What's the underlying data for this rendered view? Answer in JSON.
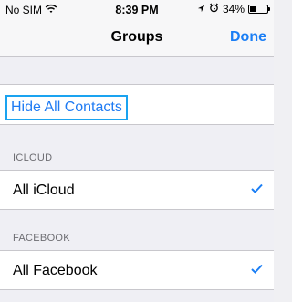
{
  "status_bar": {
    "carrier": "No SIM",
    "time": "8:39 PM",
    "battery_percent": "34%",
    "battery_level": 0.34
  },
  "nav": {
    "title": "Groups",
    "done_label": "Done"
  },
  "hide_all": {
    "label": "Hide All Contacts"
  },
  "sections": [
    {
      "header": "ICLOUD",
      "row_label": "All iCloud",
      "checked": true
    },
    {
      "header": "FACEBOOK",
      "row_label": "All Facebook",
      "checked": true
    }
  ],
  "colors": {
    "accent": "#1a7ef5",
    "highlight_border": "#1aa3f0"
  },
  "icons": {
    "wifi": "wifi-icon",
    "location": "location-arrow-icon",
    "alarm": "alarm-clock-icon",
    "battery": "battery-icon",
    "check": "checkmark-icon"
  }
}
